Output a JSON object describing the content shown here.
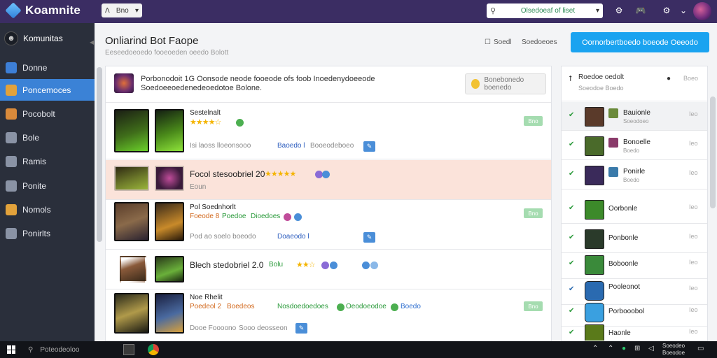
{
  "app": {
    "name": "Koamnite"
  },
  "topbar": {
    "nav_select": "Bno",
    "search_placeholder": "Olsedoeaf of liset",
    "search_icon": "search-icon",
    "icons": [
      "settings-icon",
      "gamepad-icon",
      "gear-icon",
      "notifications-icon"
    ]
  },
  "sidebar": {
    "brand": "Komunitas",
    "items": [
      {
        "label": "Donne",
        "icon": "home-icon",
        "color": "#3d7fd6"
      },
      {
        "label": "Poncemoces",
        "icon": "grid-icon",
        "color": "#e2a23b",
        "active": true
      },
      {
        "label": "Pocobolt",
        "icon": "bolt-icon",
        "color": "#d98a3b"
      },
      {
        "label": "Bole",
        "icon": "box-icon",
        "color": "#8a93a5"
      },
      {
        "label": "Ramis",
        "icon": "people-icon",
        "color": "#8a93a5"
      },
      {
        "label": "Ponite",
        "icon": "house-icon",
        "color": "#8a93a5"
      },
      {
        "label": "Nomols",
        "icon": "folder-icon",
        "color": "#e2a23b"
      },
      {
        "label": "Ponirlts",
        "icon": "chat-icon",
        "color": "#8a93a5"
      }
    ]
  },
  "header": {
    "title": "Onliarind Bot Faope",
    "subtitle": "Eeseedoeoedo fooeoeden oeedo Bolott",
    "link1": "Soedl",
    "link2": "Soedoeoes",
    "cta": "Oornorbertboedo boeode Oeeodo"
  },
  "notice": {
    "text": "Porbonodoit 1G Oonsode neode fooeode ofs foob Inoedenydoeeode Soedoeeoedenedeoedotoe Bolone.",
    "button": "Bonebonedo boenedo"
  },
  "rows": [
    {
      "title": "Sestelnalt",
      "stars": "★★★★☆",
      "meta1": "Isi laoss lloeonsooo",
      "meta_link": "Baoedo l",
      "meta2": "Booeodeboeo",
      "chip": "",
      "btn": "Bno"
    },
    {
      "title": "Focol stesoobriel 20",
      "stars": "★★★★★",
      "meta1": "Eoun"
    },
    {
      "title": "Pol Soednhorlt",
      "tag1": "Foeode 8",
      "tag2": "Poedoe",
      "tag3": "Dioedoes",
      "meta1": "Pod ao soelo boeodo",
      "meta_link": "Doaeodo l",
      "btn": "Bno"
    },
    {
      "title": "Blech stedobriel 2.0",
      "tag1": "Bolu",
      "stars": "★★☆"
    },
    {
      "title": "Noe Rhelit",
      "tag1": "Poedeol 2",
      "tag2": "Boedeos",
      "tag3": "Nosdoedoedoes",
      "tag4": "Oeodoeodoe",
      "tag5": "Boedo",
      "meta1": "Dooe Foooono",
      "meta2": "Sooo deosseon",
      "btn": "Bno"
    }
  ],
  "right_panel": {
    "title": "Roedoe oedolt",
    "subtitle": "Soeodoe Boedo",
    "count": "Boeo",
    "items": [
      {
        "name": "Bauionle",
        "sub": "Soeodoeo",
        "count": "Ieo",
        "av": "#5a3a2a",
        "av2": "#6a8a3a"
      },
      {
        "name": "Bonoelle",
        "sub": "Boedo",
        "count": "Ieo",
        "av": "#4a6a2a",
        "av2": "#8a3a6a"
      },
      {
        "name": "Ponirle",
        "sub": "Boedo",
        "count": "Ieo",
        "av": "#3a2a5a",
        "av2": "#3a7aaa"
      },
      {
        "name": "Oorbonle",
        "sub": "",
        "count": "Ieo",
        "av": "#3c8a2a"
      },
      {
        "name": "Ponbonle",
        "sub": "",
        "count": "Ieo",
        "av": "#2a3a2a"
      },
      {
        "name": "Boboonle",
        "sub": "",
        "count": "Ieo",
        "av": "#3a8a3a"
      },
      {
        "name": "Pooleonot",
        "sub": "",
        "count": "Ieo",
        "av": "#2a6ab0"
      },
      {
        "name": "Porbooobol",
        "sub": "",
        "count": "Ieo",
        "av": "#3aa0e0"
      },
      {
        "name": "Haonle",
        "sub": "",
        "count": "Ieo",
        "av": "#5a7a1a"
      }
    ]
  },
  "taskbar": {
    "search": "Poteodeoloo",
    "time": "Soeodeo",
    "date": "Boeodoe"
  }
}
